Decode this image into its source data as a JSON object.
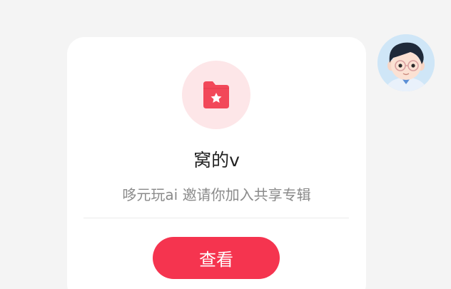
{
  "message_card": {
    "icon": "starred-folder-icon",
    "album_name": "窝的v",
    "invite_text": "哆元玩ai 邀请你加入共享专辑",
    "view_button_label": "查看",
    "accent_color": "#f5344f"
  },
  "sender": {
    "avatar": "cartoon-boy-avatar"
  }
}
